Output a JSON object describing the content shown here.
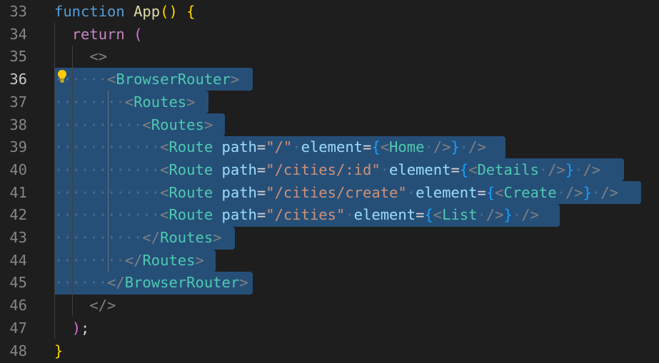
{
  "editor": {
    "line_numbers": [
      "33",
      "34",
      "35",
      "36",
      "37",
      "38",
      "39",
      "40",
      "41",
      "42",
      "43",
      "44",
      "45",
      "46",
      "47",
      "48"
    ],
    "active_line": "36",
    "lightbulb_icon": "lightbulb-icon",
    "lines": [
      [
        {
          "t": "function",
          "c": "kw-fn"
        },
        {
          "t": " ",
          "c": "plain"
        },
        {
          "t": "App",
          "c": "fname"
        },
        {
          "t": "()",
          "c": "b1"
        },
        {
          "t": " ",
          "c": "plain"
        },
        {
          "t": "{",
          "c": "b1"
        }
      ],
      [
        {
          "t": "  ",
          "c": "plain"
        },
        {
          "t": "return",
          "c": "kw-ret"
        },
        {
          "t": " ",
          "c": "plain"
        },
        {
          "t": "(",
          "c": "b2"
        }
      ],
      [
        {
          "t": "    ",
          "c": "plain"
        },
        {
          "t": "<>",
          "c": "punct"
        }
      ],
      [
        {
          "t": "····",
          "c": "dot"
        },
        {
          "t": "··",
          "c": "dot"
        },
        {
          "t": "<",
          "c": "punct"
        },
        {
          "t": "BrowserRouter",
          "c": "tag"
        },
        {
          "t": ">",
          "c": "punct"
        }
      ],
      [
        {
          "t": "········",
          "c": "dot"
        },
        {
          "t": "<",
          "c": "punct"
        },
        {
          "t": "Routes",
          "c": "tag"
        },
        {
          "t": ">",
          "c": "punct"
        }
      ],
      [
        {
          "t": "··········",
          "c": "dot"
        },
        {
          "t": "<",
          "c": "punct"
        },
        {
          "t": "Routes",
          "c": "tag"
        },
        {
          "t": ">",
          "c": "punct"
        }
      ],
      [
        {
          "t": "············",
          "c": "dot"
        },
        {
          "t": "<",
          "c": "punct"
        },
        {
          "t": "Route",
          "c": "tag"
        },
        {
          "t": " ",
          "c": "dot"
        },
        {
          "t": "path",
          "c": "attr"
        },
        {
          "t": "=",
          "c": "plain"
        },
        {
          "t": "\"/\"",
          "c": "str"
        },
        {
          "t": "·",
          "c": "dot"
        },
        {
          "t": "element",
          "c": "attr"
        },
        {
          "t": "=",
          "c": "plain"
        },
        {
          "t": "{",
          "c": "b3"
        },
        {
          "t": "<",
          "c": "punct"
        },
        {
          "t": "Home",
          "c": "tag"
        },
        {
          "t": "·",
          "c": "dot"
        },
        {
          "t": "/>",
          "c": "punct"
        },
        {
          "t": "}",
          "c": "b3"
        },
        {
          "t": "·",
          "c": "dot"
        },
        {
          "t": "/>",
          "c": "punct"
        }
      ],
      [
        {
          "t": "············",
          "c": "dot"
        },
        {
          "t": "<",
          "c": "punct"
        },
        {
          "t": "Route",
          "c": "tag"
        },
        {
          "t": " ",
          "c": "dot"
        },
        {
          "t": "path",
          "c": "attr"
        },
        {
          "t": "=",
          "c": "plain"
        },
        {
          "t": "\"/cities/:id\"",
          "c": "str"
        },
        {
          "t": "·",
          "c": "dot"
        },
        {
          "t": "element",
          "c": "attr"
        },
        {
          "t": "=",
          "c": "plain"
        },
        {
          "t": "{",
          "c": "b3"
        },
        {
          "t": "<",
          "c": "punct"
        },
        {
          "t": "Details",
          "c": "tag"
        },
        {
          "t": "·",
          "c": "dot"
        },
        {
          "t": "/>",
          "c": "punct"
        },
        {
          "t": "}",
          "c": "b3"
        },
        {
          "t": "·",
          "c": "dot"
        },
        {
          "t": "/>",
          "c": "punct"
        }
      ],
      [
        {
          "t": "············",
          "c": "dot"
        },
        {
          "t": "<",
          "c": "punct"
        },
        {
          "t": "Route",
          "c": "tag"
        },
        {
          "t": " ",
          "c": "dot"
        },
        {
          "t": "path",
          "c": "attr"
        },
        {
          "t": "=",
          "c": "plain"
        },
        {
          "t": "\"/cities/create\"",
          "c": "str"
        },
        {
          "t": "·",
          "c": "dot"
        },
        {
          "t": "element",
          "c": "attr"
        },
        {
          "t": "=",
          "c": "plain"
        },
        {
          "t": "{",
          "c": "b3"
        },
        {
          "t": "<",
          "c": "punct"
        },
        {
          "t": "Create",
          "c": "tag"
        },
        {
          "t": "·",
          "c": "dot"
        },
        {
          "t": "/>",
          "c": "punct"
        },
        {
          "t": "}",
          "c": "b3"
        },
        {
          "t": "·",
          "c": "dot"
        },
        {
          "t": "/>",
          "c": "punct"
        }
      ],
      [
        {
          "t": "············",
          "c": "dot"
        },
        {
          "t": "<",
          "c": "punct"
        },
        {
          "t": "Route",
          "c": "tag"
        },
        {
          "t": " ",
          "c": "dot"
        },
        {
          "t": "path",
          "c": "attr"
        },
        {
          "t": "=",
          "c": "plain"
        },
        {
          "t": "\"/cities\"",
          "c": "str"
        },
        {
          "t": "·",
          "c": "dot"
        },
        {
          "t": "element",
          "c": "attr"
        },
        {
          "t": "=",
          "c": "plain"
        },
        {
          "t": "{",
          "c": "b3"
        },
        {
          "t": "<",
          "c": "punct"
        },
        {
          "t": "List",
          "c": "tag"
        },
        {
          "t": "·",
          "c": "dot"
        },
        {
          "t": "/>",
          "c": "punct"
        },
        {
          "t": "}",
          "c": "b3"
        },
        {
          "t": "·",
          "c": "dot"
        },
        {
          "t": "/>",
          "c": "punct"
        }
      ],
      [
        {
          "t": "··········",
          "c": "dot"
        },
        {
          "t": "</",
          "c": "punct"
        },
        {
          "t": "Routes",
          "c": "tag"
        },
        {
          "t": ">",
          "c": "punct"
        }
      ],
      [
        {
          "t": "········",
          "c": "dot"
        },
        {
          "t": "</",
          "c": "punct"
        },
        {
          "t": "Routes",
          "c": "tag"
        },
        {
          "t": ">",
          "c": "punct"
        }
      ],
      [
        {
          "t": "······",
          "c": "dot"
        },
        {
          "t": "</",
          "c": "punct"
        },
        {
          "t": "BrowserRouter",
          "c": "tag"
        },
        {
          "t": ">",
          "c": "punct"
        }
      ],
      [
        {
          "t": "    ",
          "c": "plain"
        },
        {
          "t": "</>",
          "c": "punct"
        }
      ],
      [
        {
          "t": "  ",
          "c": "plain"
        },
        {
          "t": ")",
          "c": "b2"
        },
        {
          "t": ";",
          "c": "plain"
        }
      ],
      [
        {
          "t": "}",
          "c": "b1"
        }
      ]
    ]
  }
}
